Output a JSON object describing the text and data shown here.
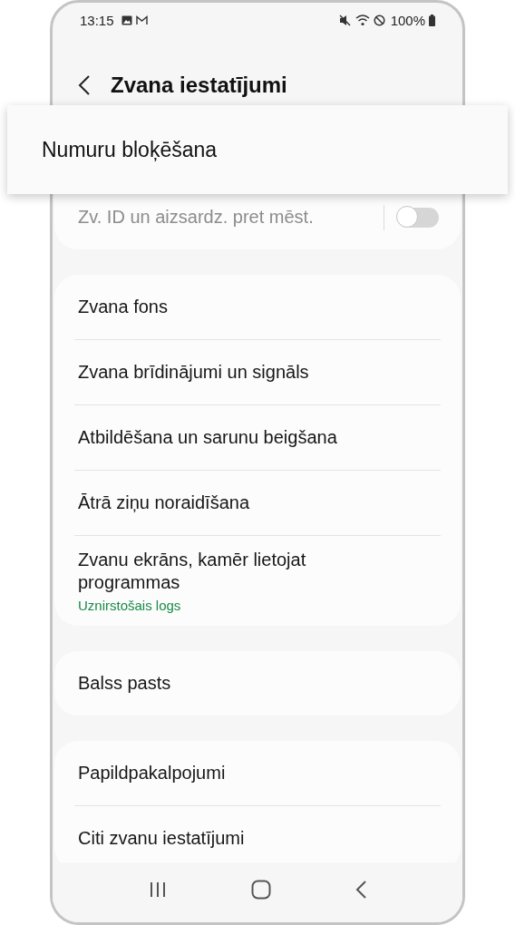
{
  "status_bar": {
    "time": "13:15",
    "battery": "100%"
  },
  "header": {
    "title": "Zvana iestatījumi"
  },
  "callout": {
    "label": "Numuru bloķēšana"
  },
  "groups": [
    {
      "items": [
        {
          "kind": "toggle",
          "label": "Zv. ID un aizsardz. pret mēst.",
          "disabled": true,
          "on": false
        }
      ]
    },
    {
      "items": [
        {
          "kind": "link",
          "label": "Zvana fons"
        },
        {
          "kind": "link",
          "label": "Zvana brīdinājumi un signāls"
        },
        {
          "kind": "link",
          "label": "Atbildēšana un sarunu beigšana"
        },
        {
          "kind": "link",
          "label": "Ātrā ziņu noraidīšana"
        },
        {
          "kind": "link",
          "label": "Zvanu ekrāns, kamēr lietojat programmas",
          "subtitle": "Uznirstošais logs"
        }
      ]
    },
    {
      "items": [
        {
          "kind": "link",
          "label": "Balss pasts"
        }
      ]
    },
    {
      "items": [
        {
          "kind": "link",
          "label": "Papildpakalpojumi"
        },
        {
          "kind": "link",
          "label": "Citi zvanu iestatījumi"
        }
      ]
    }
  ]
}
